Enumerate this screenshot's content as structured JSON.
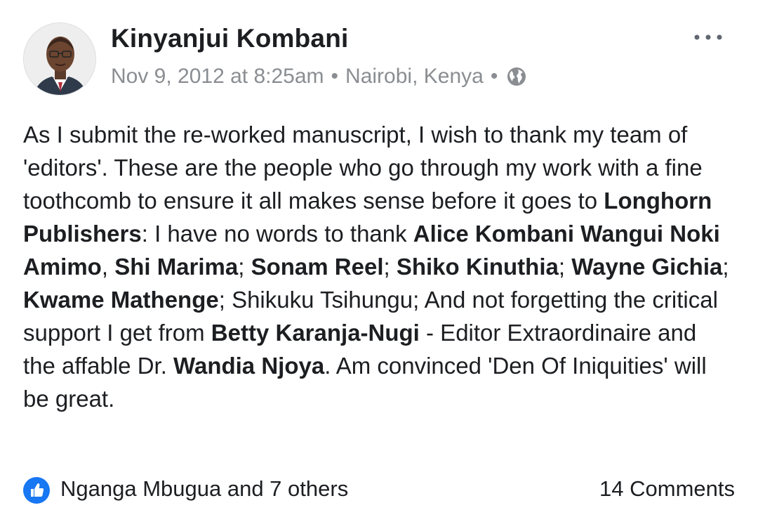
{
  "post": {
    "author": "Kinyanjui Kombani",
    "timestamp": "Nov 9, 2012 at 8:25am",
    "location": "Nairobi, Kenya",
    "separator": "•",
    "privacy_icon": "globe-icon",
    "more_icon": "more-options-icon",
    "body": [
      {
        "t": "As I submit the re-worked manuscript, I wish to thank my team of 'editors'. These are the people who go through my work with a fine toothcomb to ensure it all makes sense before it goes to ",
        "b": false
      },
      {
        "t": "Longhorn Publishers",
        "b": true
      },
      {
        "t": ": I have no words to thank ",
        "b": false
      },
      {
        "t": "Alice Kombani Wangui Noki Amimo",
        "b": true
      },
      {
        "t": ", ",
        "b": false
      },
      {
        "t": "Shi Marima",
        "b": true
      },
      {
        "t": "; ",
        "b": false
      },
      {
        "t": "Sonam Reel",
        "b": true
      },
      {
        "t": "; ",
        "b": false
      },
      {
        "t": "Shiko Kinuthia",
        "b": true
      },
      {
        "t": "; ",
        "b": false
      },
      {
        "t": "Wayne Gichia",
        "b": true
      },
      {
        "t": "; ",
        "b": false
      },
      {
        "t": "Kwame Mathenge",
        "b": true
      },
      {
        "t": "; Shikuku Tsihungu; And not forgetting the critical support I get from ",
        "b": false
      },
      {
        "t": "Betty Karanja-Nugi",
        "b": true
      },
      {
        "t": " - Editor Extraordinaire and the affable Dr. ",
        "b": false
      },
      {
        "t": "Wandia Njoya",
        "b": true
      },
      {
        "t": ". Am convinced 'Den Of Iniquities' will be great.",
        "b": false
      }
    ]
  },
  "reactions": {
    "icon": "like-icon",
    "summary": "Nganga Mbugua and 7 others",
    "comments": "14 Comments"
  },
  "colors": {
    "accent": "#1877f2",
    "meta_text": "#8a8d91",
    "text": "#1c1e21"
  }
}
